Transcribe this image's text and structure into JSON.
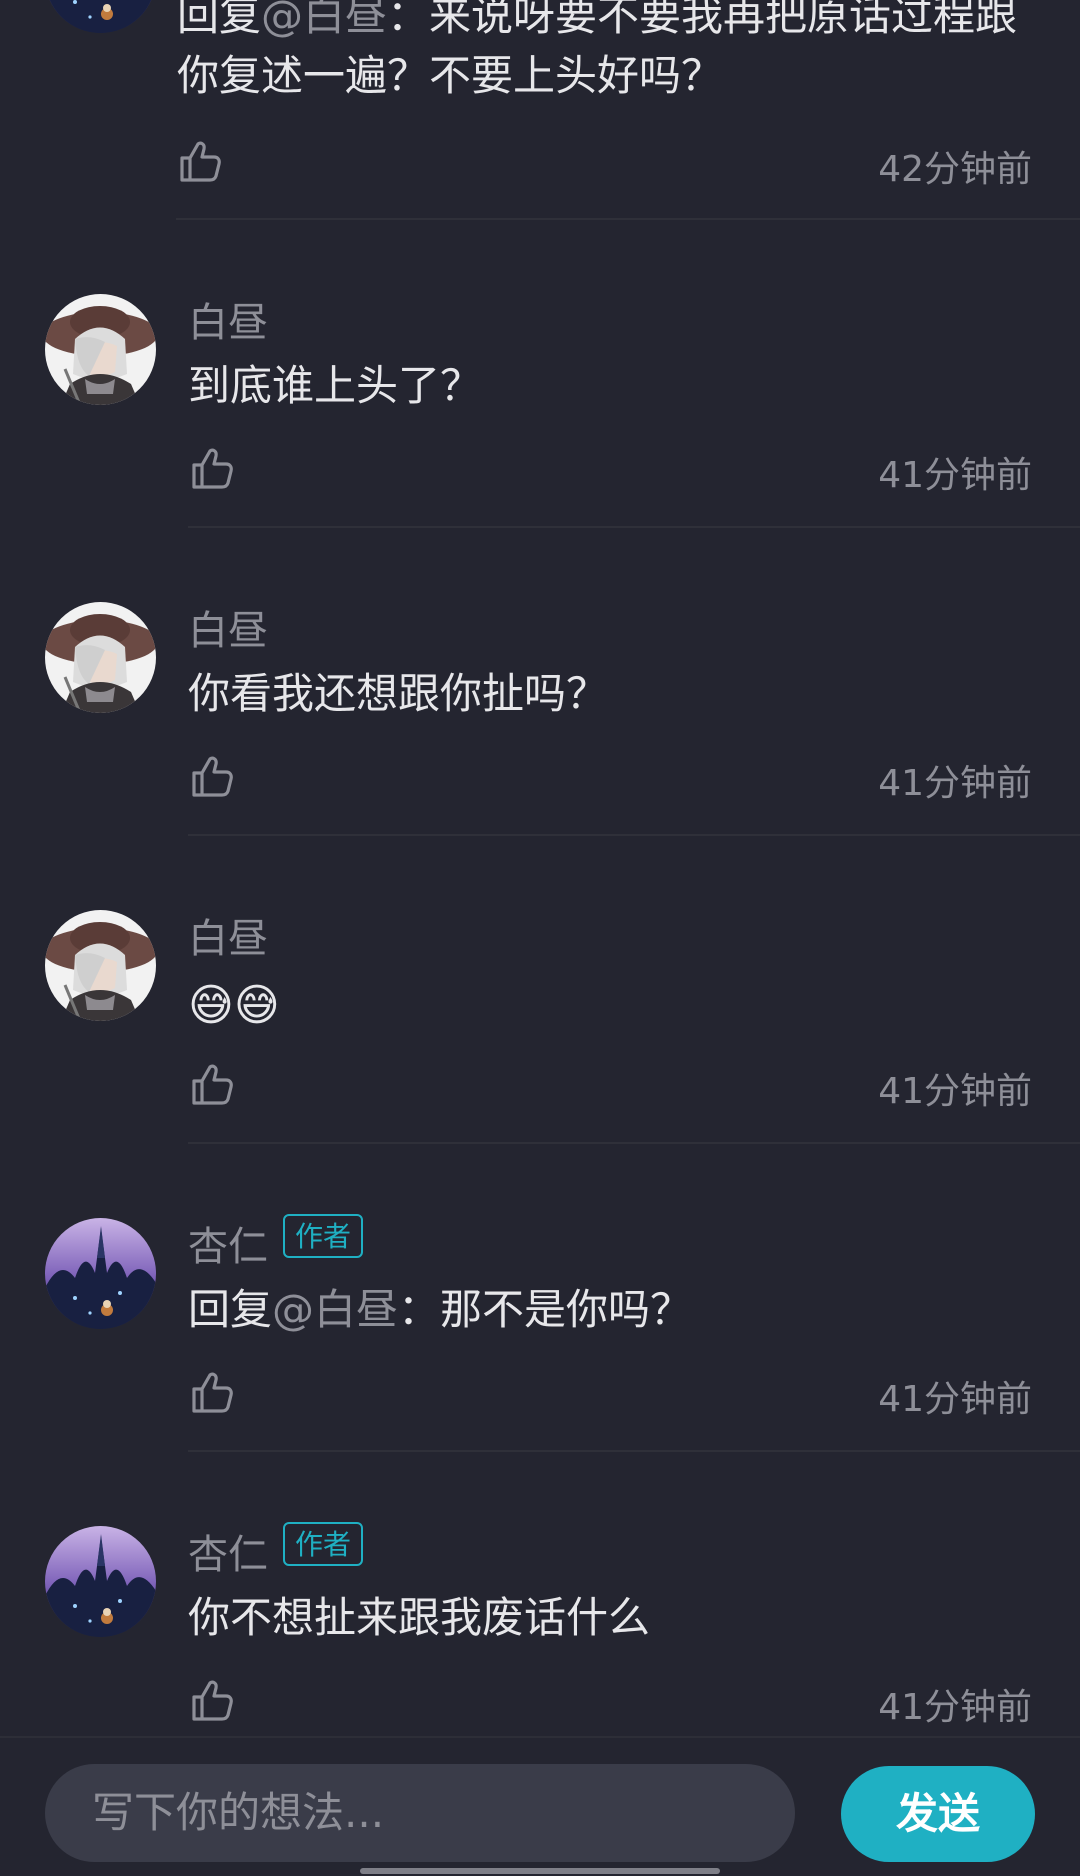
{
  "comments": [
    {
      "reply_prefix": "回复",
      "reply_target": "@白昼",
      "reply_colon": "：",
      "text_line1": "来说呀要不要我再把原话过程跟",
      "text_line2": "你复述一遍？不要上头好吗？",
      "timestamp": "42分钟前",
      "avatar": "castle-night-avatar"
    },
    {
      "username": "白昼",
      "text": "到底谁上头了？",
      "timestamp": "41分钟前",
      "avatar": "white-haired-hat-avatar"
    },
    {
      "username": "白昼",
      "text": "你看我还想跟你扯吗？",
      "timestamp": "41分钟前",
      "avatar": "white-haired-hat-avatar"
    },
    {
      "username": "白昼",
      "emoji": [
        "😅",
        "😅"
      ],
      "timestamp": "41分钟前",
      "avatar": "white-haired-hat-avatar"
    },
    {
      "username": "杏仁",
      "badge": "作者",
      "reply_prefix": "回复",
      "reply_target": "@白昼",
      "reply_colon": "：",
      "text": "那不是你吗？",
      "timestamp": "41分钟前",
      "avatar": "castle-night-avatar"
    },
    {
      "username": "杏仁",
      "badge": "作者",
      "text": "你不想扯来跟我废话什么",
      "timestamp": "41分钟前",
      "avatar": "castle-night-avatar"
    }
  ],
  "input": {
    "placeholder": "写下你的想法..."
  },
  "send_button": {
    "label": "发送"
  },
  "colors": {
    "background": "#242530",
    "accent": "#1fb0c3",
    "muted_text": "#8e8f98",
    "input_background": "#3a3c49"
  },
  "icons": {
    "like": "thumbs-up-icon"
  }
}
